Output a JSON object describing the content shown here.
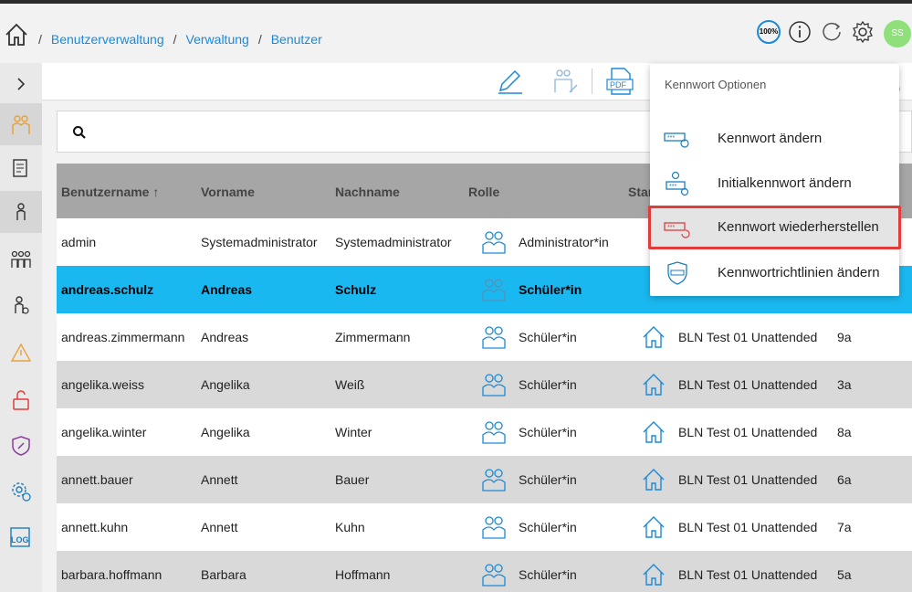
{
  "breadcrumb": [
    "Benutzerverwaltung",
    "Verwaltung",
    "Benutzer"
  ],
  "header": {
    "zoom": "100%",
    "avatar_initials": "SS"
  },
  "search": {
    "value": "",
    "placeholder": ""
  },
  "table": {
    "columns": [
      "Benutzername",
      "Vorname",
      "Nachname",
      "Rolle",
      "Star"
    ],
    "rows": [
      {
        "username": "admin",
        "first": "Systemadministrator",
        "last": "Systemadministrator",
        "role": "Administrator*in",
        "site": "",
        "class": ""
      },
      {
        "username": "andreas.schulz",
        "first": "Andreas",
        "last": "Schulz",
        "role": "Schüler*in",
        "site": "",
        "class": ""
      },
      {
        "username": "andreas.zimmermann",
        "first": "Andreas",
        "last": "Zimmermann",
        "role": "Schüler*in",
        "site": "BLN Test 01 Unattended",
        "class": "9a"
      },
      {
        "username": "angelika.weiss",
        "first": "Angelika",
        "last": "Weiß",
        "role": "Schüler*in",
        "site": "BLN Test 01 Unattended",
        "class": "3a"
      },
      {
        "username": "angelika.winter",
        "first": "Angelika",
        "last": "Winter",
        "role": "Schüler*in",
        "site": "BLN Test 01 Unattended",
        "class": "8a"
      },
      {
        "username": "annett.bauer",
        "first": "Annett",
        "last": "Bauer",
        "role": "Schüler*in",
        "site": "BLN Test 01 Unattended",
        "class": "6a"
      },
      {
        "username": "annett.kuhn",
        "first": "Annett",
        "last": "Kuhn",
        "role": "Schüler*in",
        "site": "BLN Test 01 Unattended",
        "class": "7a"
      },
      {
        "username": "barbara.hoffmann",
        "first": "Barbara",
        "last": "Hoffmann",
        "role": "Schüler*in",
        "site": "BLN Test 01 Unattended",
        "class": "5a"
      }
    ]
  },
  "toolbar": {
    "pdf_label": "PDF"
  },
  "sidebar": {
    "log_label": "LOG"
  },
  "dropdown": {
    "title": "Kennwort Optionen",
    "items": [
      "Kennwort ändern",
      "Initialkennwort ändern",
      "Kennwort wiederherstellen",
      "Kennwortrichtlinien ändern"
    ]
  },
  "colors": {
    "accent": "#1a8ad8",
    "selected_row": "#1ab8f0",
    "highlight_border": "#e03c3c",
    "sidebar_icon": "#e8a23c"
  }
}
